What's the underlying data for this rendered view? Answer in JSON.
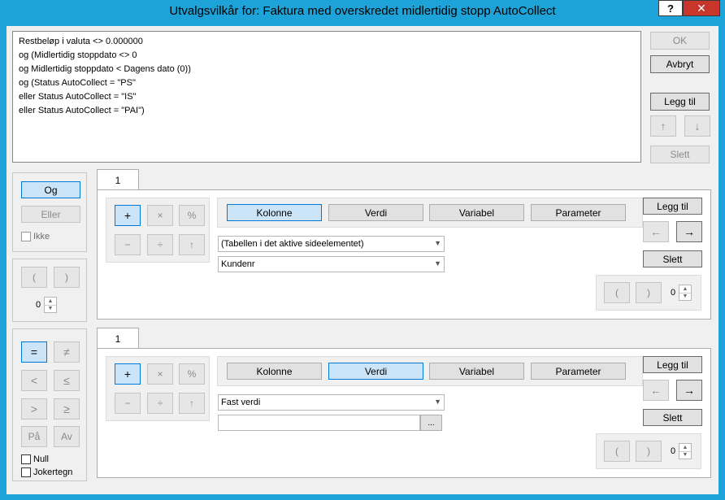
{
  "window": {
    "title": "Utvalgsvilkår for: Faktura med overskredet midlertidig stopp AutoCollect",
    "help_label": "?",
    "close_label": "✕"
  },
  "conditions": [
    "Restbeløp i valuta <> 0.000000",
    "og (Midlertidig stoppdato <> 0",
    "og Midlertidig stoppdato < Dagens dato (0))",
    "og (Status AutoCollect = \"PS\"",
    "eller Status AutoCollect = \"IS\"",
    "eller Status AutoCollect = \"PAI\")"
  ],
  "right_buttons": {
    "ok": "OK",
    "cancel": "Avbryt",
    "add": "Legg til",
    "up": "↑",
    "down": "↓",
    "delete": "Slett"
  },
  "logic": {
    "and": "Og",
    "or": "Eller",
    "not": "Ikke"
  },
  "paren": {
    "open": "(",
    "close": ")",
    "count": "0"
  },
  "comparison": {
    "eq": "=",
    "ne": "≠",
    "lt": "<",
    "le": "≤",
    "gt": ">",
    "ge": "≥",
    "on": "På",
    "off": "Av",
    "null": "Null",
    "wildcard": "Jokertegn"
  },
  "operand1": {
    "tab": "1",
    "ops": {
      "plus": "+",
      "times": "×",
      "percent": "%",
      "minus": "−",
      "divide": "÷",
      "power": "↑"
    },
    "types": [
      "Kolonne",
      "Verdi",
      "Variabel",
      "Parameter"
    ],
    "selected_type": "Kolonne",
    "combo_table": "(Tabellen i det aktive sideelementet)",
    "combo_column": "Kundenr",
    "add": "Legg til",
    "left": "←",
    "right": "→",
    "delete": "Slett",
    "paren_open": "(",
    "paren_close": ")",
    "paren_count": "0"
  },
  "operand2": {
    "tab": "1",
    "ops": {
      "plus": "+",
      "times": "×",
      "percent": "%",
      "minus": "−",
      "divide": "÷",
      "power": "↑"
    },
    "types": [
      "Kolonne",
      "Verdi",
      "Variabel",
      "Parameter"
    ],
    "selected_type": "Verdi",
    "combo_value": "Fast verdi",
    "value_input": "",
    "browse": "...",
    "add": "Legg til",
    "left": "←",
    "right": "→",
    "delete": "Slett",
    "paren_open": "(",
    "paren_close": ")",
    "paren_count": "0"
  }
}
